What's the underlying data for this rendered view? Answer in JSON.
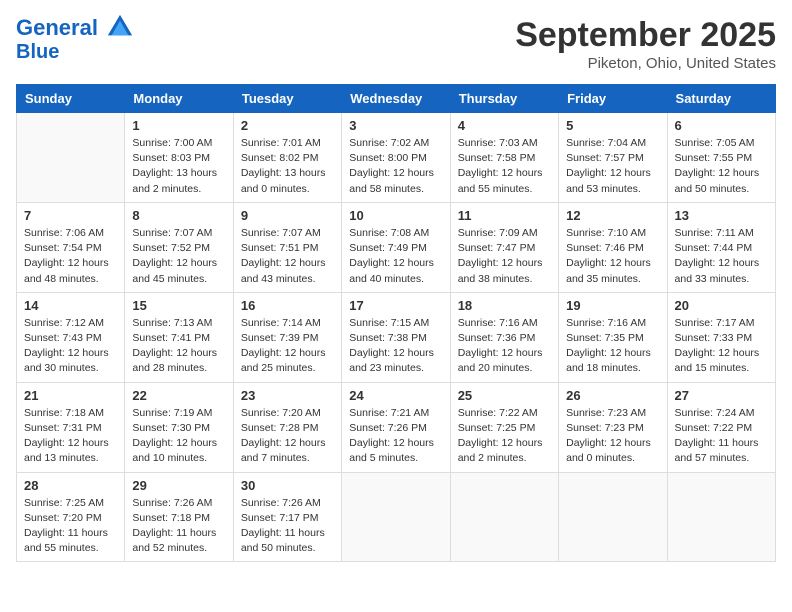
{
  "header": {
    "logo_line1": "General",
    "logo_line2": "Blue",
    "month": "September 2025",
    "location": "Piketon, Ohio, United States"
  },
  "weekdays": [
    "Sunday",
    "Monday",
    "Tuesday",
    "Wednesday",
    "Thursday",
    "Friday",
    "Saturday"
  ],
  "weeks": [
    [
      {
        "day": "",
        "sunrise": "",
        "sunset": "",
        "daylight": ""
      },
      {
        "day": "1",
        "sunrise": "Sunrise: 7:00 AM",
        "sunset": "Sunset: 8:03 PM",
        "daylight": "Daylight: 13 hours and 2 minutes."
      },
      {
        "day": "2",
        "sunrise": "Sunrise: 7:01 AM",
        "sunset": "Sunset: 8:02 PM",
        "daylight": "Daylight: 13 hours and 0 minutes."
      },
      {
        "day": "3",
        "sunrise": "Sunrise: 7:02 AM",
        "sunset": "Sunset: 8:00 PM",
        "daylight": "Daylight: 12 hours and 58 minutes."
      },
      {
        "day": "4",
        "sunrise": "Sunrise: 7:03 AM",
        "sunset": "Sunset: 7:58 PM",
        "daylight": "Daylight: 12 hours and 55 minutes."
      },
      {
        "day": "5",
        "sunrise": "Sunrise: 7:04 AM",
        "sunset": "Sunset: 7:57 PM",
        "daylight": "Daylight: 12 hours and 53 minutes."
      },
      {
        "day": "6",
        "sunrise": "Sunrise: 7:05 AM",
        "sunset": "Sunset: 7:55 PM",
        "daylight": "Daylight: 12 hours and 50 minutes."
      }
    ],
    [
      {
        "day": "7",
        "sunrise": "Sunrise: 7:06 AM",
        "sunset": "Sunset: 7:54 PM",
        "daylight": "Daylight: 12 hours and 48 minutes."
      },
      {
        "day": "8",
        "sunrise": "Sunrise: 7:07 AM",
        "sunset": "Sunset: 7:52 PM",
        "daylight": "Daylight: 12 hours and 45 minutes."
      },
      {
        "day": "9",
        "sunrise": "Sunrise: 7:07 AM",
        "sunset": "Sunset: 7:51 PM",
        "daylight": "Daylight: 12 hours and 43 minutes."
      },
      {
        "day": "10",
        "sunrise": "Sunrise: 7:08 AM",
        "sunset": "Sunset: 7:49 PM",
        "daylight": "Daylight: 12 hours and 40 minutes."
      },
      {
        "day": "11",
        "sunrise": "Sunrise: 7:09 AM",
        "sunset": "Sunset: 7:47 PM",
        "daylight": "Daylight: 12 hours and 38 minutes."
      },
      {
        "day": "12",
        "sunrise": "Sunrise: 7:10 AM",
        "sunset": "Sunset: 7:46 PM",
        "daylight": "Daylight: 12 hours and 35 minutes."
      },
      {
        "day": "13",
        "sunrise": "Sunrise: 7:11 AM",
        "sunset": "Sunset: 7:44 PM",
        "daylight": "Daylight: 12 hours and 33 minutes."
      }
    ],
    [
      {
        "day": "14",
        "sunrise": "Sunrise: 7:12 AM",
        "sunset": "Sunset: 7:43 PM",
        "daylight": "Daylight: 12 hours and 30 minutes."
      },
      {
        "day": "15",
        "sunrise": "Sunrise: 7:13 AM",
        "sunset": "Sunset: 7:41 PM",
        "daylight": "Daylight: 12 hours and 28 minutes."
      },
      {
        "day": "16",
        "sunrise": "Sunrise: 7:14 AM",
        "sunset": "Sunset: 7:39 PM",
        "daylight": "Daylight: 12 hours and 25 minutes."
      },
      {
        "day": "17",
        "sunrise": "Sunrise: 7:15 AM",
        "sunset": "Sunset: 7:38 PM",
        "daylight": "Daylight: 12 hours and 23 minutes."
      },
      {
        "day": "18",
        "sunrise": "Sunrise: 7:16 AM",
        "sunset": "Sunset: 7:36 PM",
        "daylight": "Daylight: 12 hours and 20 minutes."
      },
      {
        "day": "19",
        "sunrise": "Sunrise: 7:16 AM",
        "sunset": "Sunset: 7:35 PM",
        "daylight": "Daylight: 12 hours and 18 minutes."
      },
      {
        "day": "20",
        "sunrise": "Sunrise: 7:17 AM",
        "sunset": "Sunset: 7:33 PM",
        "daylight": "Daylight: 12 hours and 15 minutes."
      }
    ],
    [
      {
        "day": "21",
        "sunrise": "Sunrise: 7:18 AM",
        "sunset": "Sunset: 7:31 PM",
        "daylight": "Daylight: 12 hours and 13 minutes."
      },
      {
        "day": "22",
        "sunrise": "Sunrise: 7:19 AM",
        "sunset": "Sunset: 7:30 PM",
        "daylight": "Daylight: 12 hours and 10 minutes."
      },
      {
        "day": "23",
        "sunrise": "Sunrise: 7:20 AM",
        "sunset": "Sunset: 7:28 PM",
        "daylight": "Daylight: 12 hours and 7 minutes."
      },
      {
        "day": "24",
        "sunrise": "Sunrise: 7:21 AM",
        "sunset": "Sunset: 7:26 PM",
        "daylight": "Daylight: 12 hours and 5 minutes."
      },
      {
        "day": "25",
        "sunrise": "Sunrise: 7:22 AM",
        "sunset": "Sunset: 7:25 PM",
        "daylight": "Daylight: 12 hours and 2 minutes."
      },
      {
        "day": "26",
        "sunrise": "Sunrise: 7:23 AM",
        "sunset": "Sunset: 7:23 PM",
        "daylight": "Daylight: 12 hours and 0 minutes."
      },
      {
        "day": "27",
        "sunrise": "Sunrise: 7:24 AM",
        "sunset": "Sunset: 7:22 PM",
        "daylight": "Daylight: 11 hours and 57 minutes."
      }
    ],
    [
      {
        "day": "28",
        "sunrise": "Sunrise: 7:25 AM",
        "sunset": "Sunset: 7:20 PM",
        "daylight": "Daylight: 11 hours and 55 minutes."
      },
      {
        "day": "29",
        "sunrise": "Sunrise: 7:26 AM",
        "sunset": "Sunset: 7:18 PM",
        "daylight": "Daylight: 11 hours and 52 minutes."
      },
      {
        "day": "30",
        "sunrise": "Sunrise: 7:26 AM",
        "sunset": "Sunset: 7:17 PM",
        "daylight": "Daylight: 11 hours and 50 minutes."
      },
      {
        "day": "",
        "sunrise": "",
        "sunset": "",
        "daylight": ""
      },
      {
        "day": "",
        "sunrise": "",
        "sunset": "",
        "daylight": ""
      },
      {
        "day": "",
        "sunrise": "",
        "sunset": "",
        "daylight": ""
      },
      {
        "day": "",
        "sunrise": "",
        "sunset": "",
        "daylight": ""
      }
    ]
  ]
}
